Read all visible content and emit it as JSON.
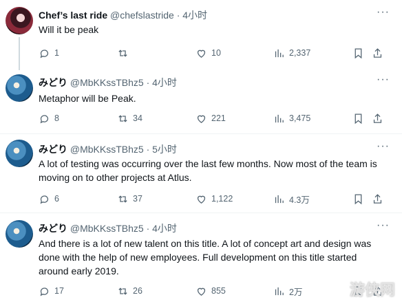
{
  "tweets": [
    {
      "name": "Chef’s last ride",
      "handle": "@chefslastride",
      "time": "· 4小时",
      "text": "Will it be peak",
      "replies": "1",
      "retweets": "",
      "likes": "10",
      "views": "2,337"
    },
    {
      "name": "みどり",
      "handle": "@MbKKssTBhz5",
      "time": "· 4小时",
      "text": "Metaphor will be Peak.",
      "replies": "8",
      "retweets": "34",
      "likes": "221",
      "views": "3,475"
    },
    {
      "name": "みどり",
      "handle": "@MbKKssTBhz5",
      "time": "· 5小时",
      "text": "A lot of testing was occurring over the last few months. Now most of the team is moving on to other projects at Atlus.",
      "replies": "6",
      "retweets": "37",
      "likes": "1,122",
      "views": "4.3万"
    },
    {
      "name": "みどり",
      "handle": "@MbKKssTBhz5",
      "time": "· 4小时",
      "text": "And there is a lot of new talent on this title. A lot of concept art and design was done with the help of new employees. Full development on this title started around early 2019.",
      "replies": "17",
      "retweets": "26",
      "likes": "855",
      "views": "2万"
    }
  ],
  "more_icon": "ellipsis-icon",
  "icons": {
    "reply": "reply-icon",
    "retweet": "retweet-icon",
    "like": "heart-icon",
    "views": "views-icon",
    "bookmark": "bookmark-icon",
    "share": "share-icon"
  },
  "watermark": "游侠网"
}
